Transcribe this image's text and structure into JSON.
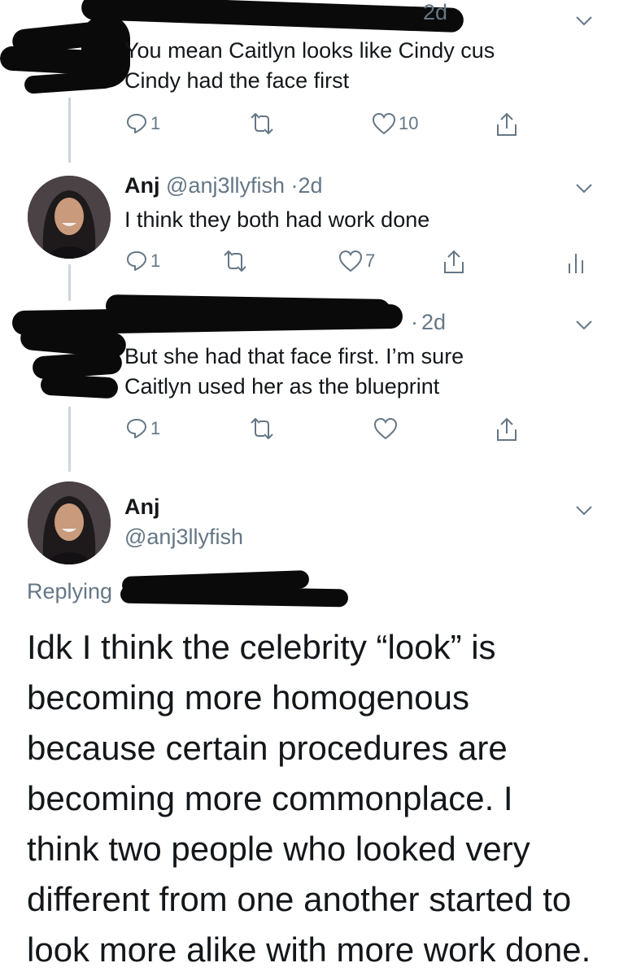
{
  "tweets": [
    {
      "time": "2d",
      "text_lines": [
        "You mean Caitlyn looks like Cindy cus",
        "Cindy had the face first"
      ],
      "replies": "1",
      "likes": "10"
    },
    {
      "name": "Anj",
      "handle": "@anj3llyfish",
      "time": "2d",
      "text": "I think they both had work done",
      "replies": "1",
      "likes": "7"
    },
    {
      "time": "2d",
      "text_lines": [
        "But she had that face first. I’m sure",
        "Caitlyn used her as the blueprint"
      ],
      "replies": "1"
    }
  ],
  "main_tweet": {
    "name": "Anj",
    "handle": "@anj3llyfish",
    "replying_label": "Replying",
    "text_lines": [
      "Idk I think the celebrity “look” is",
      "becoming more homogenous",
      "because certain procedures are",
      "becoming more commonplace. I",
      "think two people who looked very",
      "different from one another started to",
      "look more alike with more work done."
    ]
  },
  "colors": {
    "text": "#14171a",
    "secondary": "#657786",
    "thread_line": "#ccd6dd",
    "redaction": "#0a0a0a"
  },
  "icons": [
    "reply-icon",
    "retweet-icon",
    "like-icon",
    "share-icon",
    "chevron-down-icon",
    "analytics-icon"
  ]
}
